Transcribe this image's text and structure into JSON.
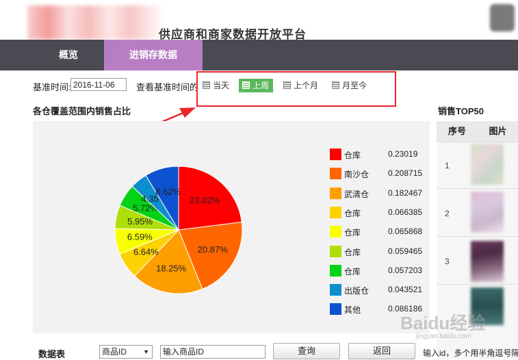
{
  "header": {
    "title": "供应商和商家数据开放平台"
  },
  "nav": {
    "tabs": [
      {
        "label": "概览"
      },
      {
        "label": "进销存数据"
      }
    ]
  },
  "filters": {
    "base_time_label": "基准时间:",
    "base_time_value": "2016-11-06",
    "view_label": "查看基准时间的",
    "periods": [
      {
        "label": "当天"
      },
      {
        "label": "上周"
      },
      {
        "label": "上个月"
      },
      {
        "label": "月至今"
      }
    ],
    "active_period": "上周"
  },
  "pie_section": {
    "title": "各仓覆盖范围内销售占比"
  },
  "top50": {
    "title": "销售TOP50",
    "col_index": "序号",
    "col_image": "图片",
    "rows": [
      "1",
      "2",
      "3"
    ]
  },
  "bottom": {
    "table_label": "数据表",
    "select_value": "商品ID",
    "input_placeholder": "输入商品ID",
    "query_label": "查询",
    "back_label": "返回",
    "hint": "输入id，多个用半角逗号隔"
  },
  "chart_data": {
    "type": "pie",
    "slices": [
      {
        "name": "仓库",
        "value": 0.23019,
        "value_label": "0.23019",
        "pct": "23.02%",
        "color": "#ff0000"
      },
      {
        "name": "南沙仓",
        "value": 0.208715,
        "value_label": "0.208715",
        "pct": "20.87%",
        "color": "#ff6600"
      },
      {
        "name": "武清仓",
        "value": 0.182467,
        "value_label": "0.182467",
        "pct": "18.25%",
        "color": "#ff9e01"
      },
      {
        "name": "仓库",
        "value": 0.066385,
        "value_label": "0.066385",
        "pct": "6.64%",
        "color": "#fcd202"
      },
      {
        "name": "仓库",
        "value": 0.065868,
        "value_label": "0.065868",
        "pct": "6.59%",
        "color": "#f8ff01"
      },
      {
        "name": "仓库",
        "value": 0.059465,
        "value_label": "0.059465",
        "pct": "5.95%",
        "color": "#b0de09"
      },
      {
        "name": "仓库",
        "value": 0.057203,
        "value_label": "0.057203",
        "pct": "5.72%",
        "color": "#04d215"
      },
      {
        "name": "出版仓",
        "value": 0.043521,
        "value_label": "0.043521",
        "pct": "4.35%",
        "color": "#0d8ecf"
      },
      {
        "name": "其他",
        "value": 0.086186,
        "value_label": "0.086186",
        "pct": "8.62%",
        "color": "#0d52d1"
      }
    ]
  },
  "watermark": {
    "text": "Baidu经验",
    "sub": "jingyan.baidu.com"
  }
}
